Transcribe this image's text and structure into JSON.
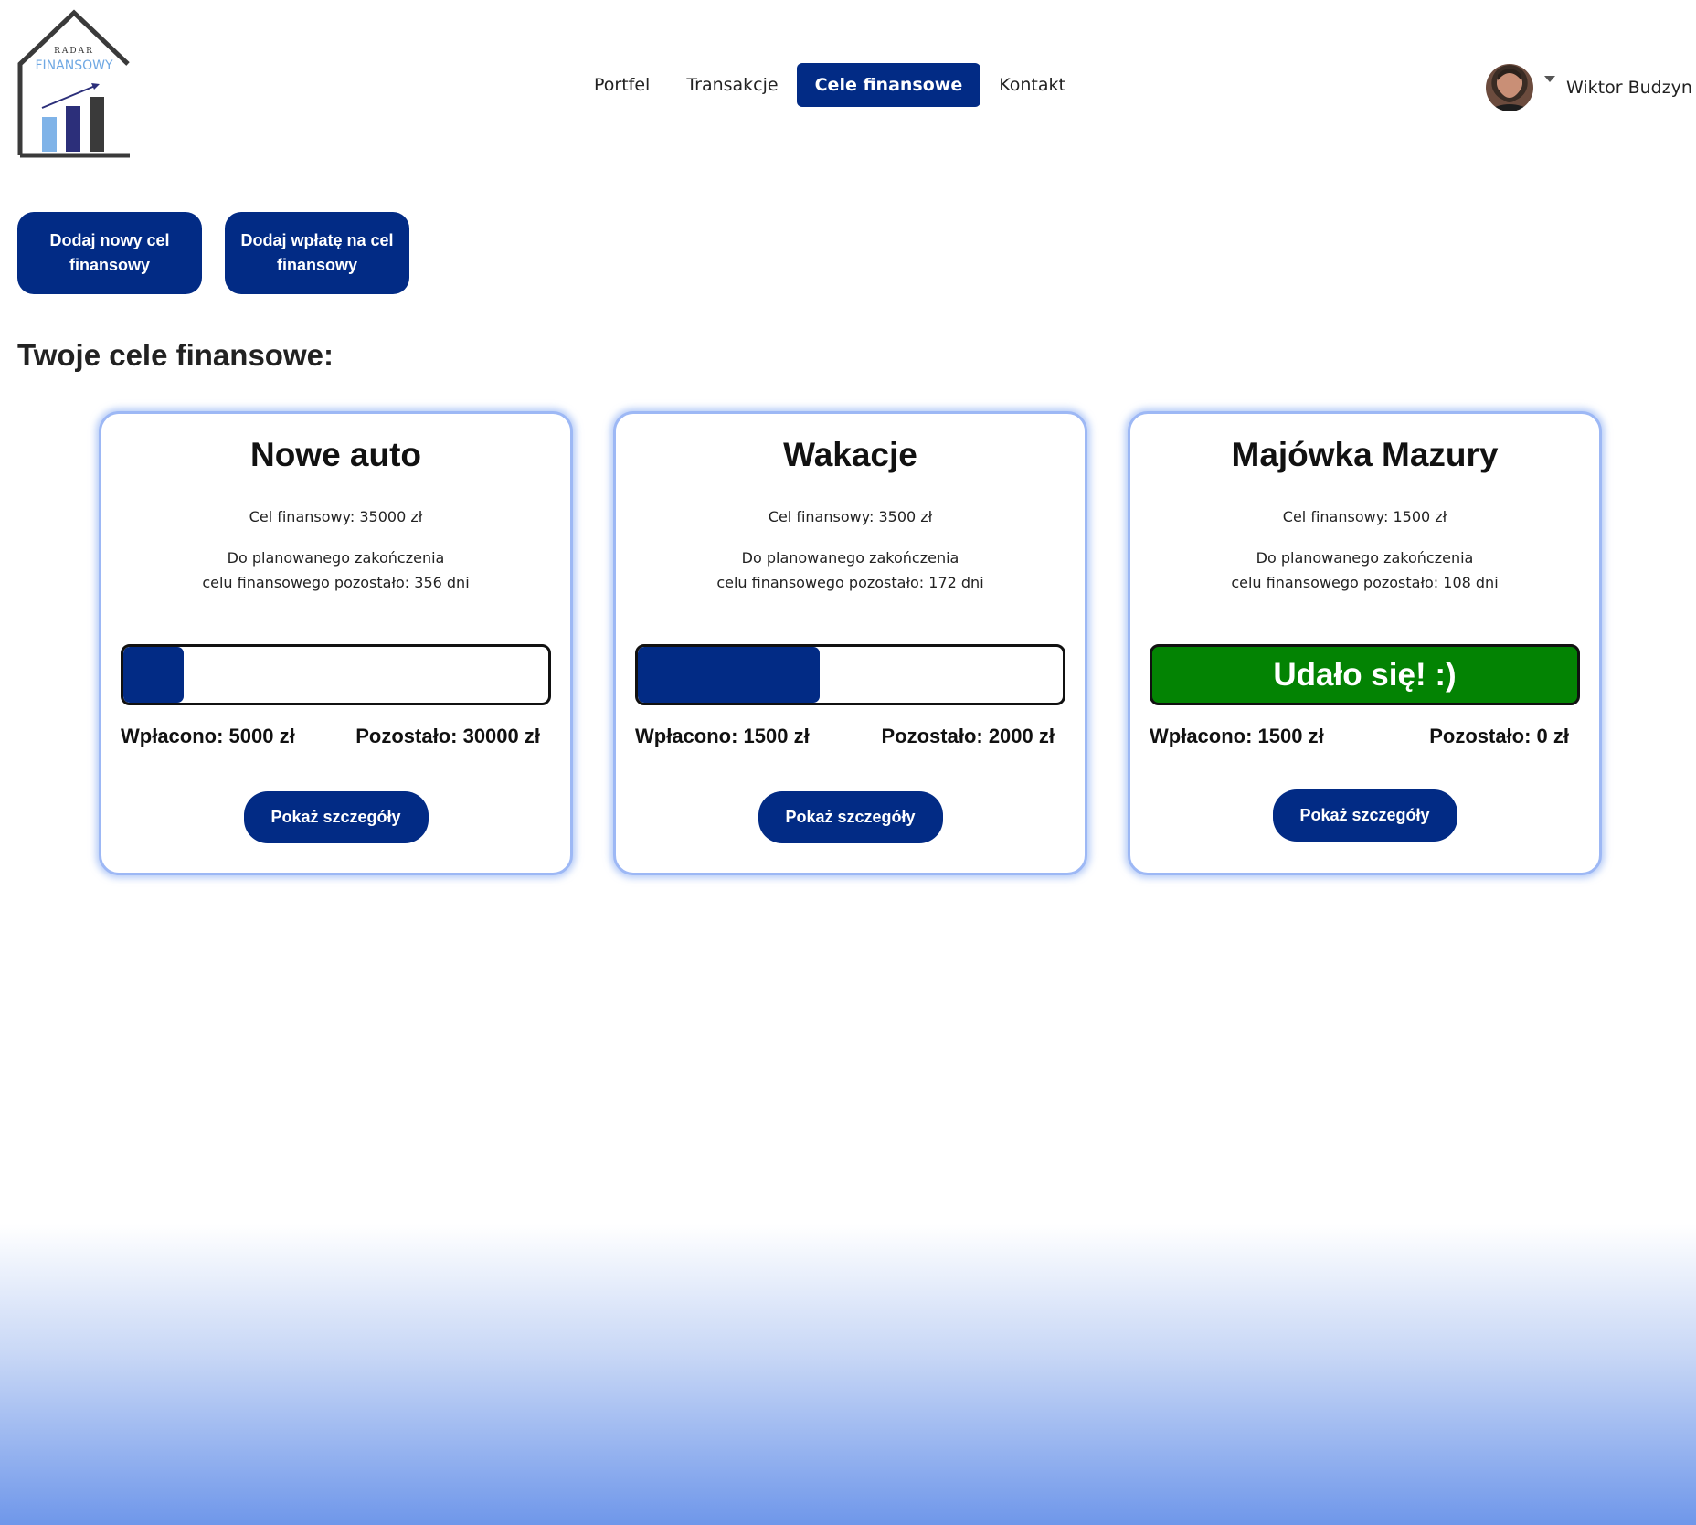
{
  "header": {
    "logo": {
      "top_text": "RADAR",
      "main_text": "FINANSOWY"
    },
    "nav": [
      {
        "label": "Portfel",
        "active": false
      },
      {
        "label": "Transakcje",
        "active": false
      },
      {
        "label": "Cele finansowe",
        "active": true
      },
      {
        "label": "Kontakt",
        "active": false
      }
    ],
    "user": {
      "name": "Wiktor Budzyn",
      "avatar_icon": "user-avatar",
      "menu_icon": "caret-down-icon"
    }
  },
  "actions": {
    "add_goal": "Dodaj nowy cel finansowy",
    "add_payment": "Dodaj wpłatę na cel finansowy"
  },
  "page_title": "Twoje cele finansowe:",
  "goals": [
    {
      "title": "Nowe auto",
      "target": "Cel finansowy: 35000 zł",
      "deadline_line1": "Do planowanego zakończenia",
      "deadline_line2": "celu finansowego pozostało: 356 dni",
      "progress": 0.1429,
      "done_text": "",
      "paid": "Wpłacono: 5000 zł",
      "remaining": "Pozostało: 30000 zł",
      "button": "Pokaż szczegóły"
    },
    {
      "title": "Wakacje",
      "target": "Cel finansowy: 3500 zł",
      "deadline_line1": "Do planowanego zakończenia",
      "deadline_line2": "celu finansowego pozostało: 172 dni",
      "progress": 0.4286,
      "done_text": "",
      "paid": "Wpłacono: 1500 zł",
      "remaining": "Pozostało: 2000 zł",
      "button": "Pokaż szczegóły"
    },
    {
      "title": "Majówka Mazury",
      "target": "Cel finansowy: 1500 zł",
      "deadline_line1": "Do planowanego zakończenia",
      "deadline_line2": "celu finansowego pozostało: 108 dni",
      "progress": 1,
      "done_text": "Udało się! :)",
      "paid": "Wpłacono: 1500 zł",
      "remaining": "Pozostało: 0 zł",
      "button": "Pokaż szczegóły"
    }
  ],
  "colors": {
    "primary": "#022b85",
    "success": "#038303",
    "card_border": "#9db8f5"
  }
}
